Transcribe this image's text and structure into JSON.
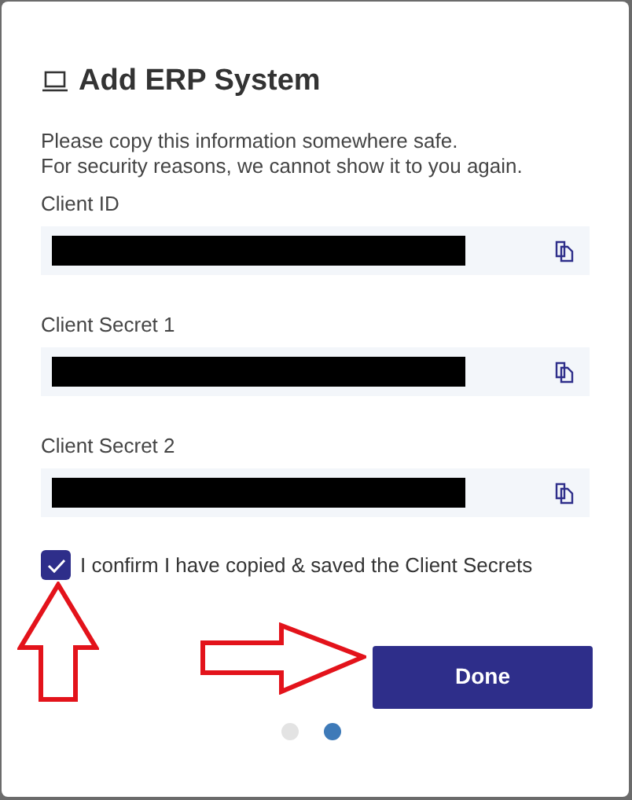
{
  "dialog": {
    "title": "Add ERP System",
    "message_lines": [
      "Please copy this information somewhere safe.",
      "For security reasons, we cannot show it to you again."
    ],
    "fields": [
      {
        "label": "Client ID"
      },
      {
        "label": "Client Secret 1"
      },
      {
        "label": "Client Secret 2"
      }
    ],
    "confirm": {
      "label": "I confirm I have copied & saved the Client Secrets",
      "checked": true
    },
    "done_button": "Done",
    "pages": [
      {
        "selected": false
      },
      {
        "selected": true
      }
    ]
  }
}
